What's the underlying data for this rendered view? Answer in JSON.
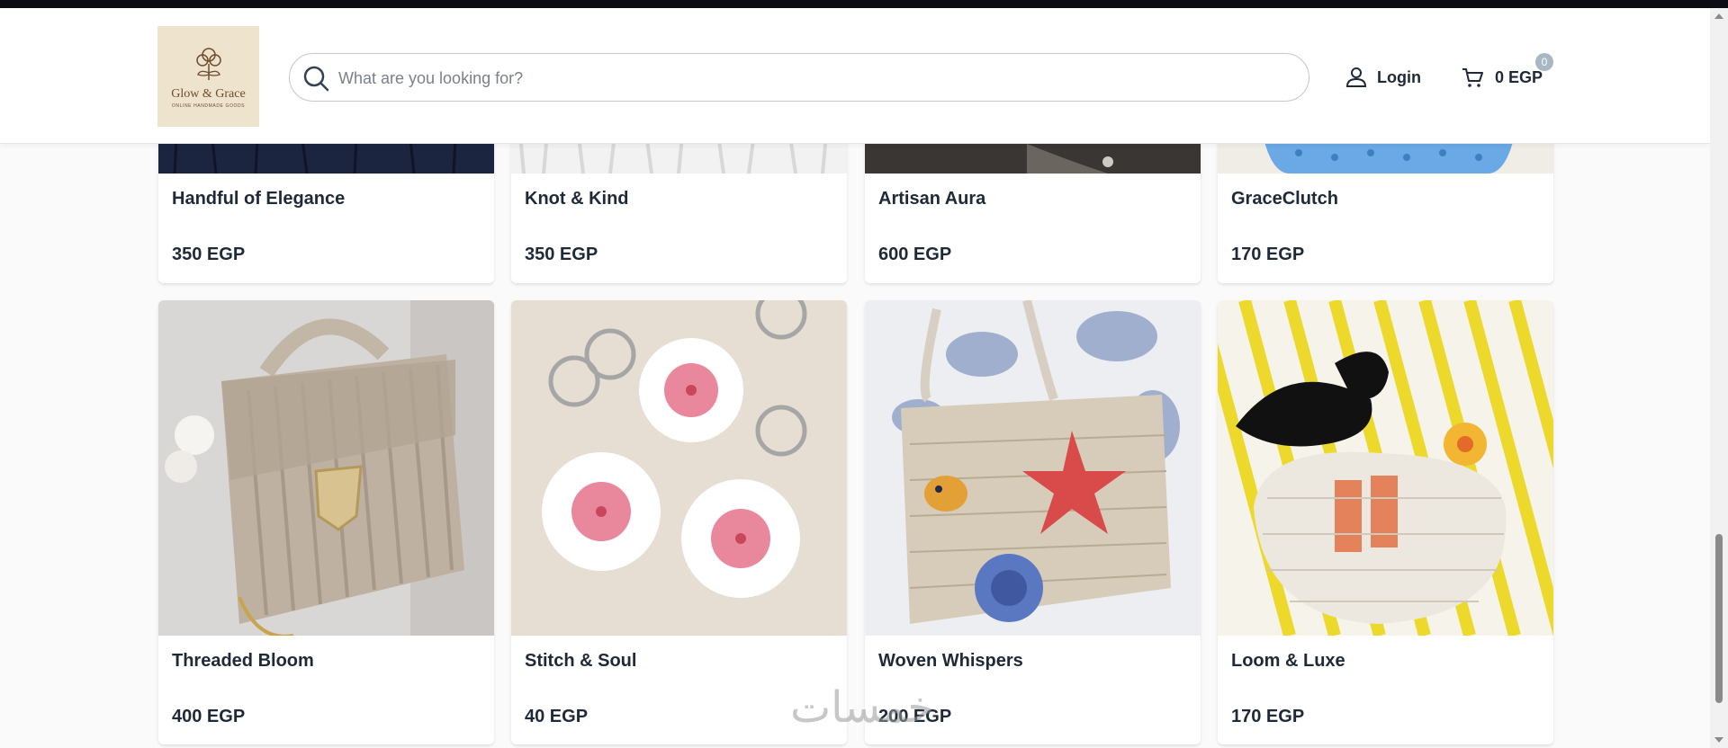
{
  "header": {
    "logo": {
      "name": "Glow & Grace",
      "tagline": "ONLINE HANDMADE GOODS",
      "icon": "flower-icon"
    },
    "search": {
      "placeholder": "What are you looking for?",
      "value": "",
      "icon": "search-icon"
    },
    "login": {
      "label": "Login",
      "icon": "user-icon"
    },
    "cart": {
      "total": "0 EGP",
      "count": "0",
      "icon": "cart-icon"
    }
  },
  "products_top": [
    {
      "name": "Handful of Elegance",
      "price": "350 EGP"
    },
    {
      "name": "Knot & Kind",
      "price": "350 EGP"
    },
    {
      "name": "Artisan Aura",
      "price": "600 EGP"
    },
    {
      "name": "GraceClutch",
      "price": "170 EGP"
    }
  ],
  "products": [
    {
      "name": "Threaded Bloom",
      "price": "400 EGP"
    },
    {
      "name": "Stitch & Soul",
      "price": "40 EGP"
    },
    {
      "name": "Woven Whispers",
      "price": "200 EGP"
    },
    {
      "name": "Loom & Luxe",
      "price": "170 EGP"
    }
  ],
  "watermark": {
    "text": "خمسات"
  },
  "colors": {
    "accent": "#1f2937",
    "logo_bg": "#eee3cc",
    "badge": "#a9b7c5"
  }
}
